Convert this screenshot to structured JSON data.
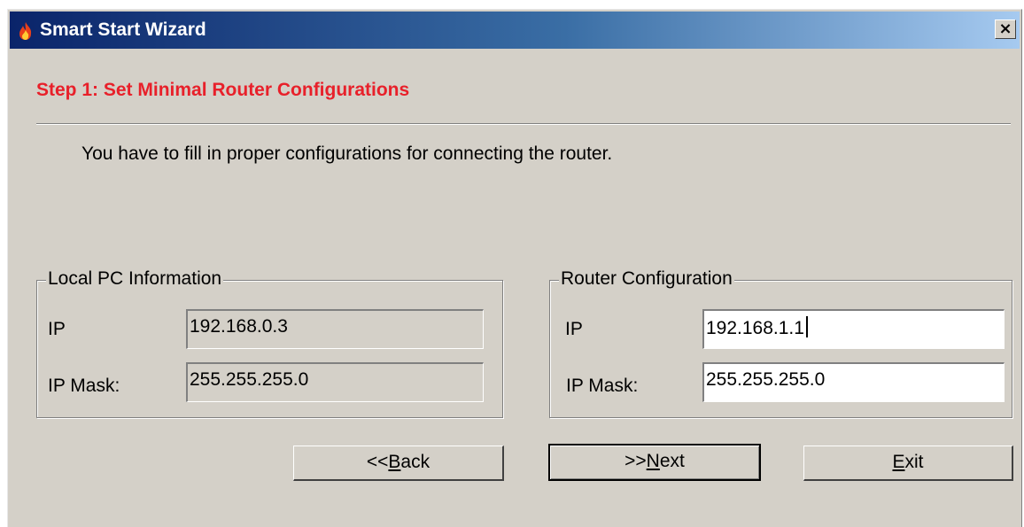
{
  "window": {
    "title": "Smart Start Wizard",
    "icon": "fire-icon",
    "close_label": "×"
  },
  "step": {
    "title": "Step 1: Set Minimal Router Configurations",
    "description": "You have to fill in proper configurations for connecting the router."
  },
  "local_pc": {
    "group_label": "Local PC Information",
    "ip_label": "IP",
    "ip_value": "192.168.0.3",
    "mask_label": "IP Mask:",
    "mask_value": "255.255.255.0"
  },
  "router": {
    "group_label": "Router Configuration",
    "ip_label": "IP",
    "ip_value": "192.168.1.1",
    "mask_label": "IP Mask:",
    "mask_value": "255.255.255.0"
  },
  "buttons": {
    "back_prefix": "<<",
    "back_mnemonic": "B",
    "back_rest": "ack",
    "next_prefix": ">>",
    "next_mnemonic": "N",
    "next_rest": "ext",
    "exit_mnemonic": "E",
    "exit_rest": "xit"
  },
  "colors": {
    "step_title": "#e8202a",
    "titlebar_start": "#0a246a",
    "titlebar_end": "#a6caf0",
    "dialog_bg": "#d4d0c8"
  }
}
